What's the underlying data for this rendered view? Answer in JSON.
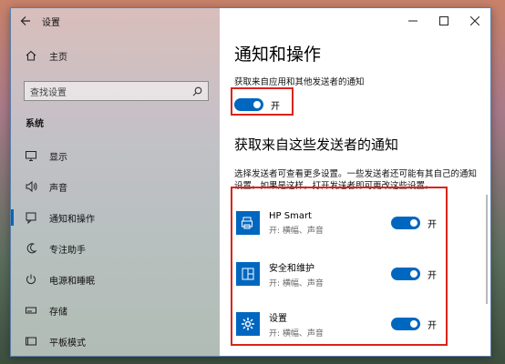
{
  "app": {
    "title": "设置"
  },
  "sidebar": {
    "home": "主页",
    "search_placeholder": "查找设置",
    "section": "系统",
    "items": [
      {
        "label": "显示",
        "icon": "display-icon"
      },
      {
        "label": "声音",
        "icon": "speaker-icon"
      },
      {
        "label": "通知和操作",
        "icon": "notification-icon",
        "active": true
      },
      {
        "label": "专注助手",
        "icon": "moon-icon"
      },
      {
        "label": "电源和睡眠",
        "icon": "power-icon"
      },
      {
        "label": "存储",
        "icon": "storage-icon"
      },
      {
        "label": "平板模式",
        "icon": "tablet-icon"
      }
    ]
  },
  "content": {
    "title": "通知和操作",
    "get_notifications_desc": "获取来自应用和其他发送者的通知",
    "main_toggle": "开",
    "senders_title": "获取来自这些发送者的通知",
    "senders_desc": "选择发送者可查看更多设置。一些发送者还可能有其自己的通知设置。如果是这样，打开发送者即可更改这些设置。",
    "senders": [
      {
        "name": "HP Smart",
        "sub": "开: 横幅、声音",
        "toggle": "开"
      },
      {
        "name": "安全和维护",
        "sub": "开: 横幅、声音",
        "toggle": "开"
      },
      {
        "name": "设置",
        "sub": "开: 横幅、声音",
        "toggle": "开"
      }
    ]
  },
  "colors": {
    "accent": "#0067c0",
    "highlight": "#d9241c"
  }
}
